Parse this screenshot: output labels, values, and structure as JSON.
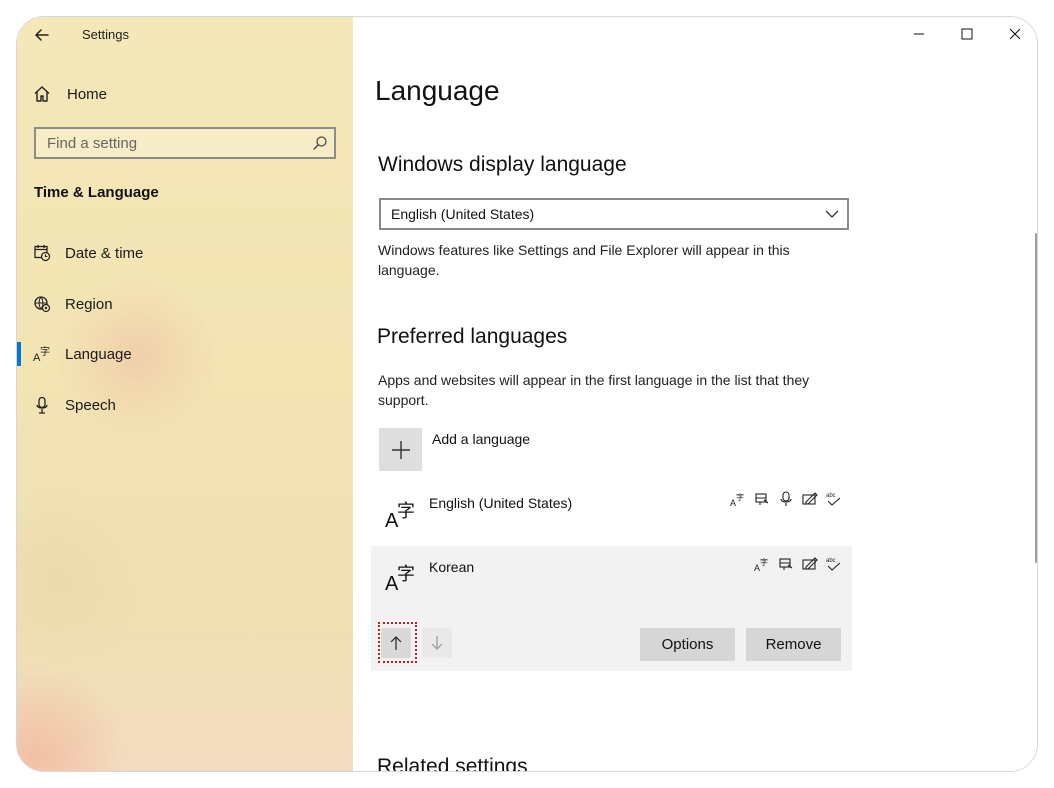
{
  "app": {
    "title": "Settings"
  },
  "sidebar": {
    "home_label": "Home",
    "search_placeholder": "Find a setting",
    "section_heading": "Time & Language",
    "items": [
      {
        "label": "Date & time",
        "icon": "calendar-clock-icon"
      },
      {
        "label": "Region",
        "icon": "globe-gear-icon"
      },
      {
        "label": "Language",
        "icon": "language-icon",
        "selected": true
      },
      {
        "label": "Speech",
        "icon": "microphone-icon"
      }
    ],
    "accent_color": "#0078d7",
    "background_color": "#f3e6b6"
  },
  "main": {
    "page_title": "Language",
    "display_language": {
      "heading": "Windows display language",
      "selected_value": "English (United States)",
      "description": "Windows features like Settings and File Explorer will appear in this language."
    },
    "preferred_languages": {
      "heading": "Preferred languages",
      "description": "Apps and websites will appear in the first language in the list that they support.",
      "add_label": "Add a language",
      "languages": [
        {
          "name": "English (United States)",
          "features": [
            "language-pack-icon",
            "text-to-speech-icon",
            "speech-recognition-icon",
            "handwriting-icon",
            "spell-check-icon"
          ]
        },
        {
          "name": "Korean",
          "selected": true,
          "features": [
            "language-pack-icon",
            "text-to-speech-icon",
            "handwriting-icon",
            "spell-check-icon"
          ]
        }
      ],
      "options_label": "Options",
      "remove_label": "Remove"
    },
    "related_heading": "Related settings"
  },
  "window_controls": {
    "minimize": "minimize-icon",
    "maximize": "maximize-icon",
    "close": "close-icon"
  }
}
